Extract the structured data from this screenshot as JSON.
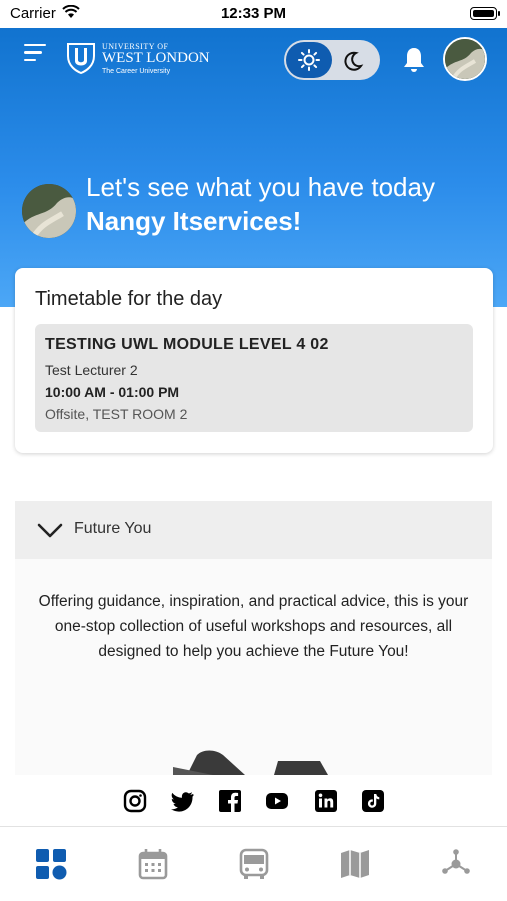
{
  "status_bar": {
    "carrier": "Carrier",
    "time": "12:33 PM"
  },
  "header": {
    "logo_line1": "UNIVERSITY OF",
    "logo_line2": "WEST LONDON",
    "logo_tagline": "The Career University"
  },
  "greeting": {
    "line1": "Let's see what you have today",
    "name": "Nangy Itservices!"
  },
  "timetable": {
    "title": "Timetable for the day",
    "events": [
      {
        "module": "TESTING UWL MODULE LEVEL 4 02",
        "lecturer": "Test Lecturer 2",
        "time": "10:00 AM - 01:00 PM",
        "location": "Offsite, TEST ROOM 2"
      }
    ]
  },
  "future_you": {
    "label": "Future You",
    "description": "Offering guidance, inspiration, and practical advice, this is your one-stop collection of useful workshops and resources, all designed to help you achieve the Future You!"
  },
  "social": [
    "instagram-icon",
    "twitter-icon",
    "facebook-icon",
    "youtube-icon",
    "linkedin-icon",
    "tiktok-icon"
  ],
  "tabbar": [
    "dashboard-icon",
    "calendar-icon",
    "bus-icon",
    "map-icon",
    "network-icon"
  ],
  "colors": {
    "primary": "#0f5cb0",
    "hero_top": "#1173cf",
    "hero_bottom": "#4ca7f6",
    "tab_inactive": "#9a9a9a"
  }
}
